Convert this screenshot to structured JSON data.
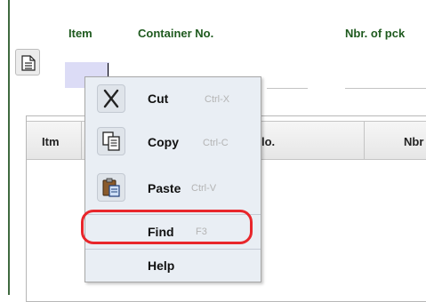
{
  "form": {
    "headers": {
      "item": "Item",
      "container_no": "Container No.",
      "nbr_of_pck": "Nbr. of pck"
    },
    "item_value": ""
  },
  "table": {
    "columns": [
      "Itm",
      "lo.",
      "Nbr"
    ]
  },
  "context_menu": {
    "items": [
      {
        "label": "Cut",
        "shortcut": "Ctrl-X",
        "icon": "scissors-icon"
      },
      {
        "label": "Copy",
        "shortcut": "Ctrl-C",
        "icon": "copy-icon"
      },
      {
        "label": "Paste",
        "shortcut": "Ctrl-V",
        "icon": "paste-icon"
      },
      {
        "label": "Find",
        "shortcut": "F3"
      },
      {
        "label": "Help",
        "shortcut": ""
      }
    ]
  },
  "colors": {
    "header_text": "#1f5a1f",
    "menu_background": "#e9eef4",
    "highlight_border": "#e8262b",
    "input_background": "#dcdcf6"
  }
}
